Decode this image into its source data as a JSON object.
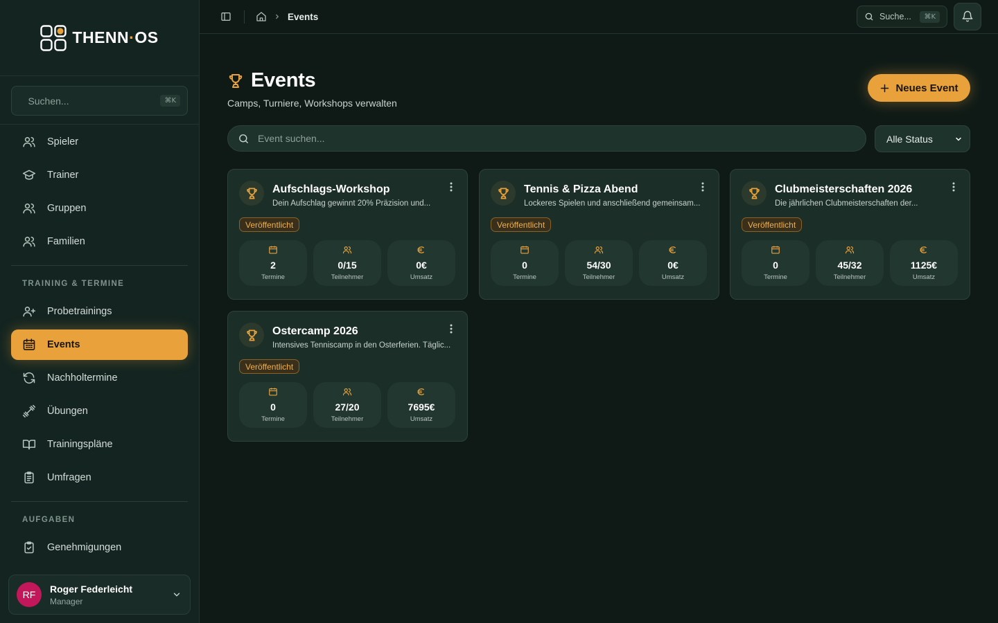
{
  "brand": {
    "name_part1": "THENN",
    "name_dot": "·",
    "name_part2": "OS"
  },
  "sidebar": {
    "search_placeholder": "Suchen...",
    "search_shortcut": "⌘K",
    "items_main": [
      {
        "label": "Spieler",
        "icon": "users-icon"
      },
      {
        "label": "Trainer",
        "icon": "graduation-cap-icon"
      },
      {
        "label": "Gruppen",
        "icon": "users-icon"
      },
      {
        "label": "Familien",
        "icon": "users-icon"
      }
    ],
    "section_training": "TRAINING & TERMINE",
    "items_training": [
      {
        "label": "Probetrainings",
        "icon": "user-plus-icon"
      },
      {
        "label": "Events",
        "icon": "calendar-icon",
        "active": true
      },
      {
        "label": "Nachholtermine",
        "icon": "refresh-icon"
      },
      {
        "label": "Übungen",
        "icon": "dumbbell-icon"
      },
      {
        "label": "Trainingspläne",
        "icon": "book-icon"
      },
      {
        "label": "Umfragen",
        "icon": "clipboard-icon"
      }
    ],
    "section_tasks": "AUFGABEN",
    "items_tasks": [
      {
        "label": "Genehmigungen",
        "icon": "clipboard-check-icon"
      }
    ],
    "user": {
      "initials": "RF",
      "name": "Roger Federleicht",
      "role": "Manager"
    }
  },
  "topbar": {
    "breadcrumb_current": "Events",
    "search_label": "Suche...",
    "search_shortcut": "⌘K"
  },
  "main": {
    "title": "Events",
    "subtitle": "Camps, Turniere, Workshops verwalten",
    "new_button": "Neues Event",
    "search_placeholder": "Event suchen...",
    "status_filter": "Alle Status",
    "stat_labels": {
      "dates": "Termine",
      "participants": "Teilnehmer",
      "revenue": "Umsatz"
    },
    "events": [
      {
        "title": "Aufschlags-Workshop",
        "description": "Dein Aufschlag gewinnt 20% Präzision und...",
        "status": "Veröffentlicht",
        "dates": "2",
        "participants": "0/15",
        "revenue": "0€"
      },
      {
        "title": "Tennis & Pizza Abend",
        "description": "Lockeres Spielen und anschließend gemeinsam...",
        "status": "Veröffentlicht",
        "dates": "0",
        "participants": "54/30",
        "revenue": "0€"
      },
      {
        "title": "Clubmeisterschaften 2026",
        "description": "Die jährlichen Clubmeisterschaften der...",
        "status": "Veröffentlicht",
        "dates": "0",
        "participants": "45/32",
        "revenue": "1125€"
      },
      {
        "title": "Ostercamp 2026",
        "description": "Intensives Tenniscamp in den Osterferien. Täglic...",
        "status": "Veröffentlicht",
        "dates": "0",
        "participants": "27/20",
        "revenue": "7695€"
      }
    ]
  },
  "colors": {
    "accent": "#e9a23b",
    "background": "#0f1a17",
    "sidebar": "#142420",
    "card": "#1b2e28",
    "avatar": "#c2185b"
  }
}
